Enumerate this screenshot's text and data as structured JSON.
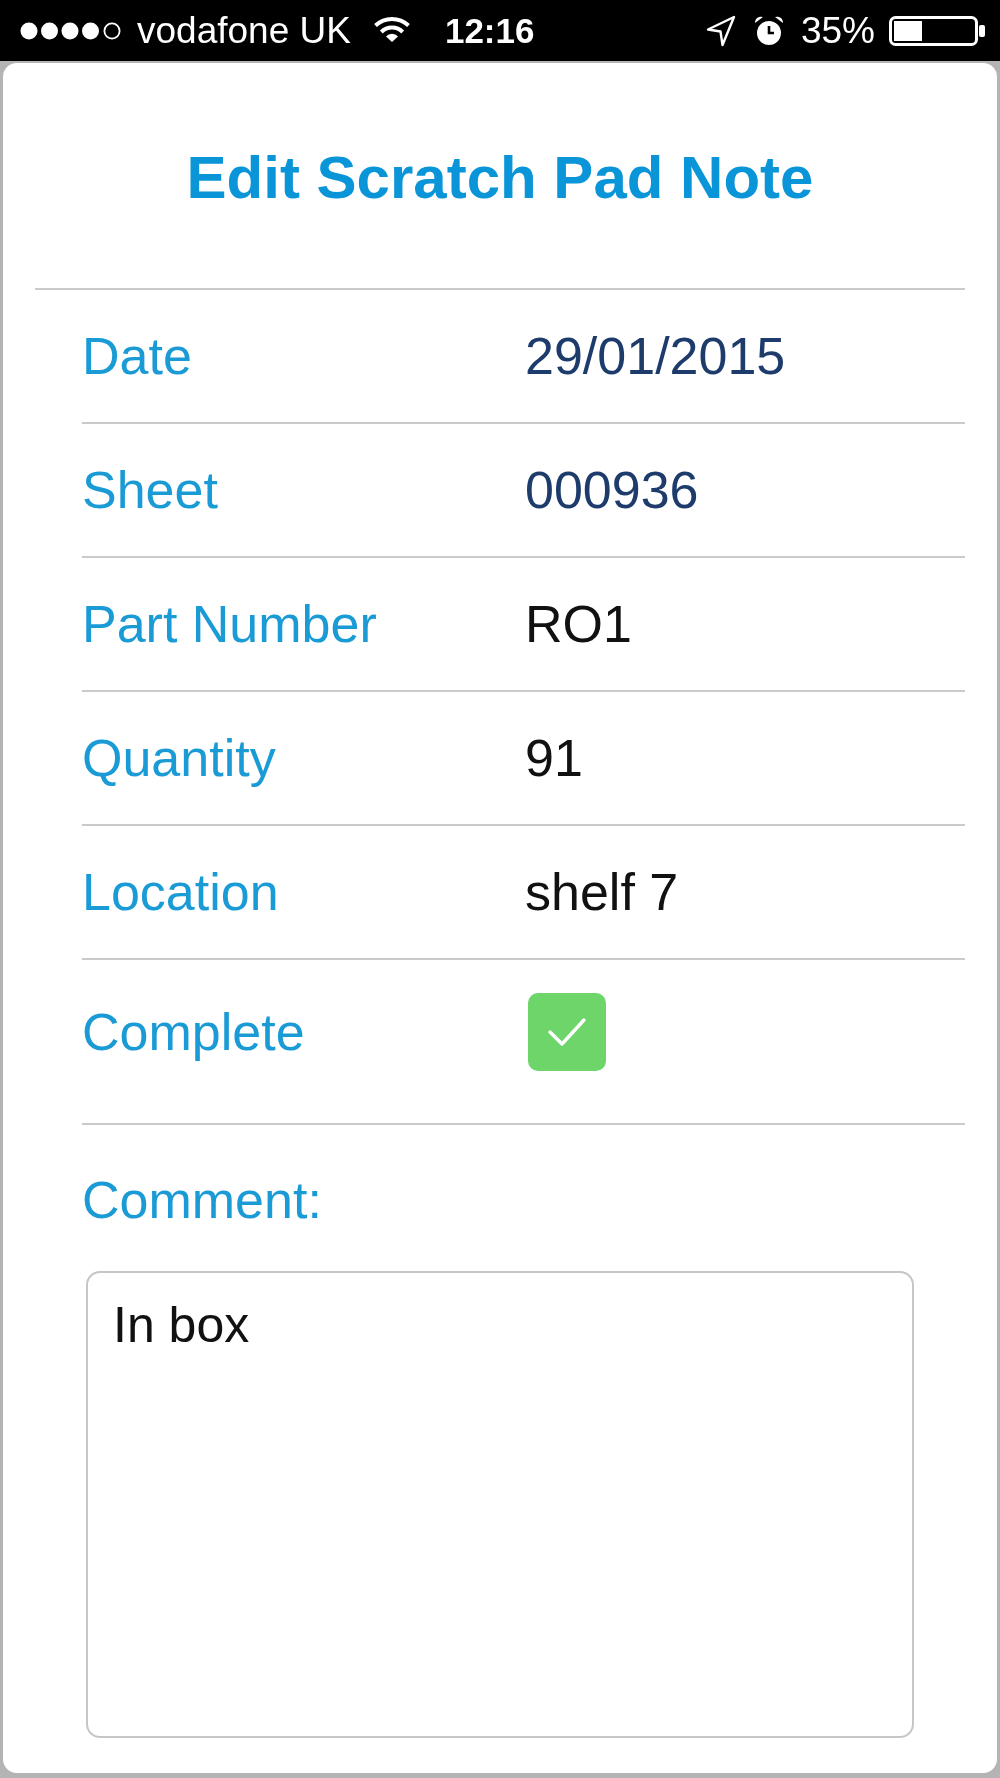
{
  "status_bar": {
    "carrier": "vodafone UK",
    "time": "12:16",
    "battery": "35%"
  },
  "title": "Edit Scratch Pad Note",
  "fields": [
    {
      "kind": "text",
      "label": "Date",
      "value": "29/01/2015",
      "editable": false
    },
    {
      "kind": "text",
      "label": "Sheet",
      "value": "000936",
      "editable": false
    },
    {
      "kind": "text",
      "label": "Part Number",
      "value": "RO1",
      "editable": true
    },
    {
      "kind": "text",
      "label": "Quantity",
      "value": "91",
      "editable": true
    },
    {
      "kind": "text",
      "label": "Location",
      "value": "shelf 7",
      "editable": true
    },
    {
      "kind": "checkbox",
      "label": "Complete",
      "checked": true
    }
  ],
  "comment": {
    "label": "Comment:",
    "value": "In box"
  }
}
